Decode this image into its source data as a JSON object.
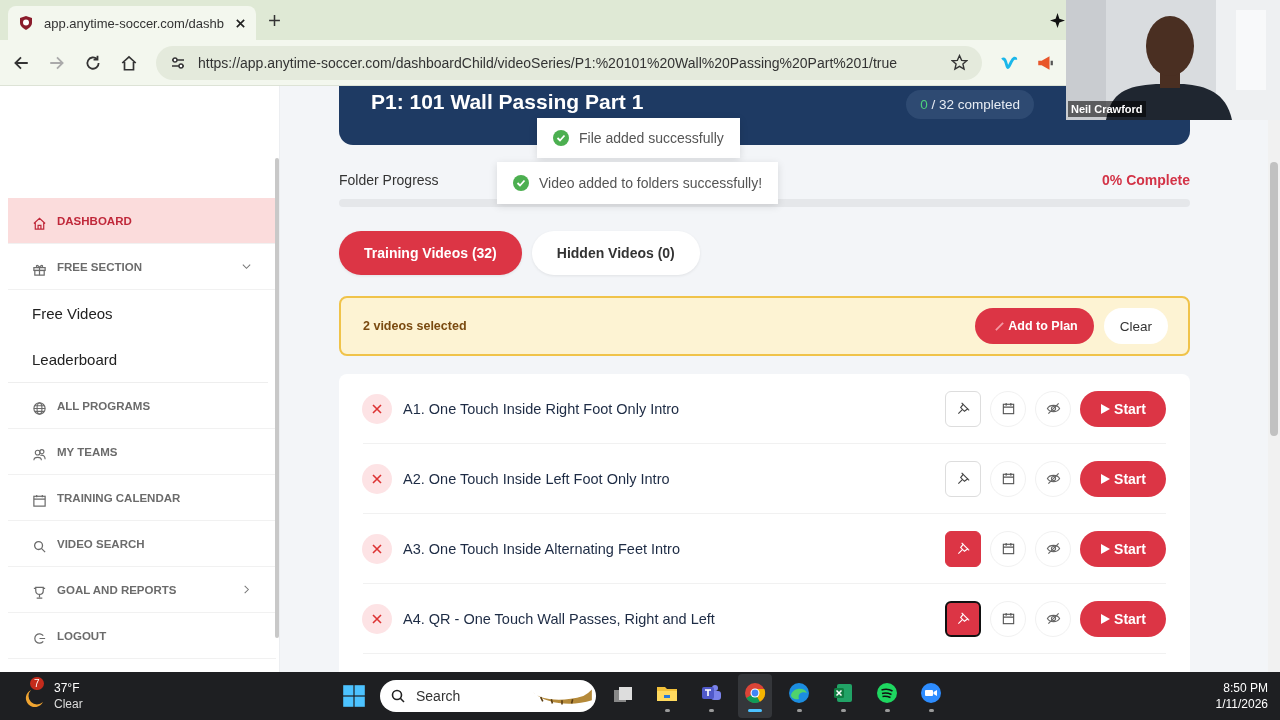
{
  "browser": {
    "tab": {
      "title": "app.anytime-soccer.com/dashb"
    },
    "url": "https://app.anytime-soccer.com/dashboardChild/videoSeries/P1:%20101%20Wall%20Passing%20Part%201/true",
    "forward_disabled": true
  },
  "webcam": {
    "name": "Neil Crawford"
  },
  "sidebar": {
    "items": [
      {
        "kind": "home",
        "label": "DASHBOARD",
        "selected": true
      },
      {
        "kind": "gift",
        "label": "FREE SECTION",
        "selected": false,
        "expanded": true,
        "children": [
          {
            "label": "Free Videos"
          },
          {
            "label": "Leaderboard"
          }
        ]
      },
      {
        "kind": "globe",
        "label": "ALL PROGRAMS",
        "selected": false
      },
      {
        "kind": "team",
        "label": "MY TEAMS",
        "selected": false
      },
      {
        "kind": "calendar",
        "label": "TRAINING CALENDAR",
        "selected": false
      },
      {
        "kind": "search",
        "label": "VIDEO SEARCH",
        "selected": false
      },
      {
        "kind": "trophy",
        "label": "GOAL AND REPORTS",
        "selected": false,
        "expanded": false
      },
      {
        "kind": "logout",
        "label": "LOGOUT",
        "selected": false
      }
    ]
  },
  "header": {
    "title": "P1: 101 Wall Passing Part 1",
    "completed_count": "0",
    "completed_rest": "/ 32 completed"
  },
  "toasts": [
    {
      "message": "File added successfully"
    },
    {
      "message": "Video added to folders successfully!"
    }
  ],
  "folder_progress": {
    "label": "Folder Progress",
    "reading": "0% Complete",
    "level": 0
  },
  "tabs": [
    {
      "label": "Training Videos (32)",
      "selected": true
    },
    {
      "label": "Hidden Videos (0)",
      "selected": false
    }
  ],
  "selection_bar": {
    "text": "2 videos selected",
    "add_button": "Add to Plan",
    "clear_button": "Clear"
  },
  "videos": [
    {
      "title": "A1. One Touch Inside Right Foot Only Intro",
      "pinned": false,
      "focused": false,
      "start_label": "Start"
    },
    {
      "title": "A2. One Touch Inside Left Foot Only Intro",
      "pinned": false,
      "focused": false,
      "start_label": "Start"
    },
    {
      "title": "A3. One Touch Inside Alternating Feet Intro",
      "pinned": true,
      "focused": false,
      "start_label": "Start"
    },
    {
      "title": "A4. QR - One Touch Wall Passes, Right and Left",
      "pinned": true,
      "focused": true,
      "start_label": "Start"
    }
  ],
  "taskbar": {
    "weather": {
      "badge": "7",
      "temperature": "37°F",
      "condition": "Clear"
    },
    "search": {
      "placeholder": "Search"
    },
    "apps": [
      {
        "kind": "taskview",
        "selected": false
      },
      {
        "kind": "explorer",
        "selected": false
      },
      {
        "kind": "teams",
        "selected": false
      },
      {
        "kind": "chrome",
        "selected": true
      },
      {
        "kind": "edge",
        "selected": false
      },
      {
        "kind": "excel",
        "selected": false
      },
      {
        "kind": "spotify",
        "selected": false
      },
      {
        "kind": "zoom",
        "selected": false
      }
    ],
    "time": "8:50 PM",
    "date": "1/11/2026"
  }
}
